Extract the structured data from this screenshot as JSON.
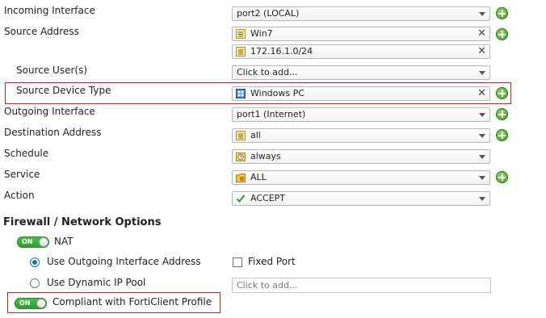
{
  "policy": {
    "incoming_interface": {
      "label": "Incoming Interface",
      "value": "port2 (LOCAL)"
    },
    "source_address": {
      "label": "Source Address",
      "values": [
        "Win7",
        "172.16.1.0/24"
      ]
    },
    "source_users": {
      "label": "Source User(s)",
      "placeholder": "Click to add..."
    },
    "source_device_type": {
      "label": "Source Device Type",
      "value": "Windows PC"
    },
    "outgoing_interface": {
      "label": "Outgoing Interface",
      "value": "port1 (Internet)"
    },
    "destination_address": {
      "label": "Destination Address",
      "value": "all"
    },
    "schedule": {
      "label": "Schedule",
      "value": "always"
    },
    "service": {
      "label": "Service",
      "value": "ALL"
    },
    "action": {
      "label": "Action",
      "value": "ACCEPT"
    }
  },
  "firewall_options": {
    "title": "Firewall / Network Options",
    "nat": {
      "toggle": "ON",
      "label": "NAT"
    },
    "use_outgoing": {
      "label": "Use Outgoing Interface Address",
      "selected": true
    },
    "fixed_port": {
      "label": "Fixed Port",
      "checked": false
    },
    "dynamic_pool": {
      "label": "Use Dynamic IP Pool",
      "selected": false,
      "placeholder": "Click to add..."
    },
    "forticlient": {
      "toggle": "ON",
      "label": "Compliant with FortiClient Profile"
    }
  },
  "colors": {
    "highlight_border": "#c0272d",
    "toggle_green": "#3aa83a",
    "plus_green": "#4caf2a",
    "radio_blue": "#1a6fc9"
  }
}
